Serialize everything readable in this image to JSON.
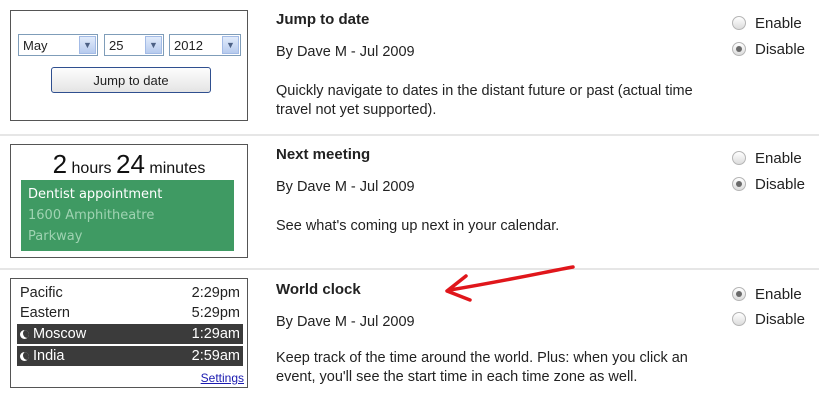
{
  "gadgets": [
    {
      "title": "Jump to date",
      "byline": "By Dave M - Jul 2009",
      "description": "Quickly navigate to dates in the distant future or past (actual time travel not yet supported).",
      "enable_label": "Enable",
      "disable_label": "Disable",
      "selected": "disable",
      "preview": {
        "month": "May",
        "day": "25",
        "year": "2012",
        "button_label": "Jump to date"
      }
    },
    {
      "title": "Next meeting",
      "byline": "By Dave M - Jul 2009",
      "description": "See what's coming up next in your calendar.",
      "enable_label": "Enable",
      "disable_label": "Disable",
      "selected": "disable",
      "preview": {
        "hours_value": "2",
        "hours_unit": "hours",
        "minutes_value": "24",
        "minutes_unit": "minutes",
        "event_title": "Dentist appointment",
        "event_location_line1": "1600 Amphitheatre",
        "event_location_line2": "Parkway",
        "card_color": "#3f9a63"
      }
    },
    {
      "title": "World clock",
      "byline": "By Dave M - Jul 2009",
      "description": "Keep track of the time around the world. Plus: when you click an event, you'll see the start time in each time zone as well.",
      "enable_label": "Enable",
      "disable_label": "Disable",
      "selected": "enable",
      "preview": {
        "zones": [
          {
            "name": "Pacific",
            "time": "2:29pm",
            "night": false
          },
          {
            "name": "Eastern",
            "time": "5:29pm",
            "night": false
          },
          {
            "name": "Moscow",
            "time": "1:29am",
            "night": true
          },
          {
            "name": "India",
            "time": "2:59am",
            "night": true
          }
        ],
        "settings_label": "Settings"
      }
    }
  ],
  "icons": {
    "dropdown": "chevron-down-icon",
    "night": "moon-icon",
    "annotation": "red-arrow-icon"
  },
  "colors": {
    "annotation": "#e0161b",
    "night_row": "#3b3b3b",
    "link": "#1a1ab0"
  }
}
